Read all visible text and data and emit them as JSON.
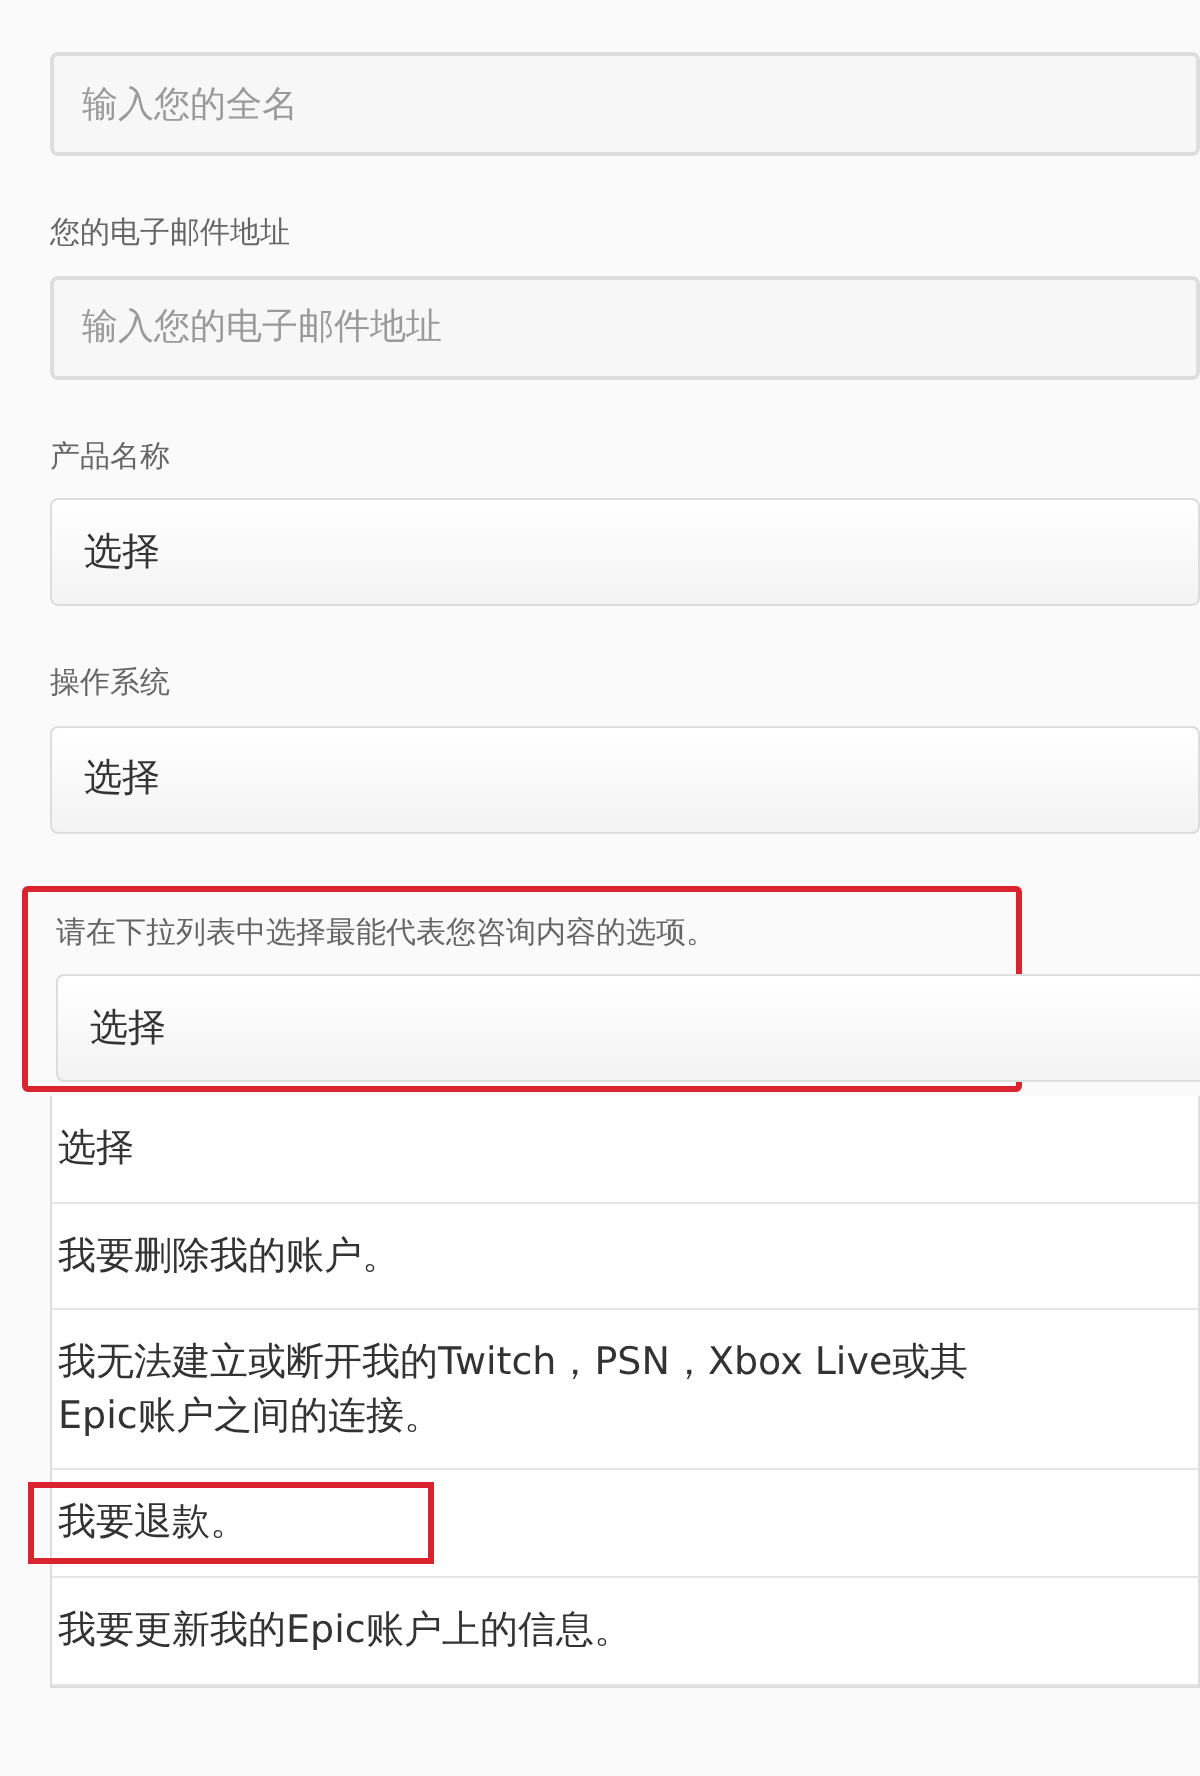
{
  "fields": [
    {
      "kind": "input",
      "placeholder": "输入您的全名",
      "highlighted": false
    },
    {
      "kind": "input",
      "label": "您的电子邮件地址",
      "placeholder": "输入您的电子邮件地址",
      "highlighted": false
    },
    {
      "kind": "select",
      "label": "产品名称",
      "value": "选择",
      "highlighted": false
    },
    {
      "kind": "select",
      "label": "操作系统",
      "value": "选择",
      "highlighted": false
    },
    {
      "kind": "select",
      "label": "请在下拉列表中选择最能代表您咨询内容的选项。",
      "value": "选择",
      "highlighted": true,
      "expanded": true
    }
  ],
  "dropdown_options": [
    {
      "text": "选择",
      "highlighted": false
    },
    {
      "text": "我要删除我的账户。",
      "highlighted": false
    },
    {
      "text": "我无法建立或断开我的Twitch，PSN，Xbox Live或其\nEpic账户之间的连接。",
      "highlighted": false
    },
    {
      "text": "我要退款。",
      "highlighted": true
    },
    {
      "text": "我要更新我的Epic账户上的信息。",
      "highlighted": false
    }
  ]
}
